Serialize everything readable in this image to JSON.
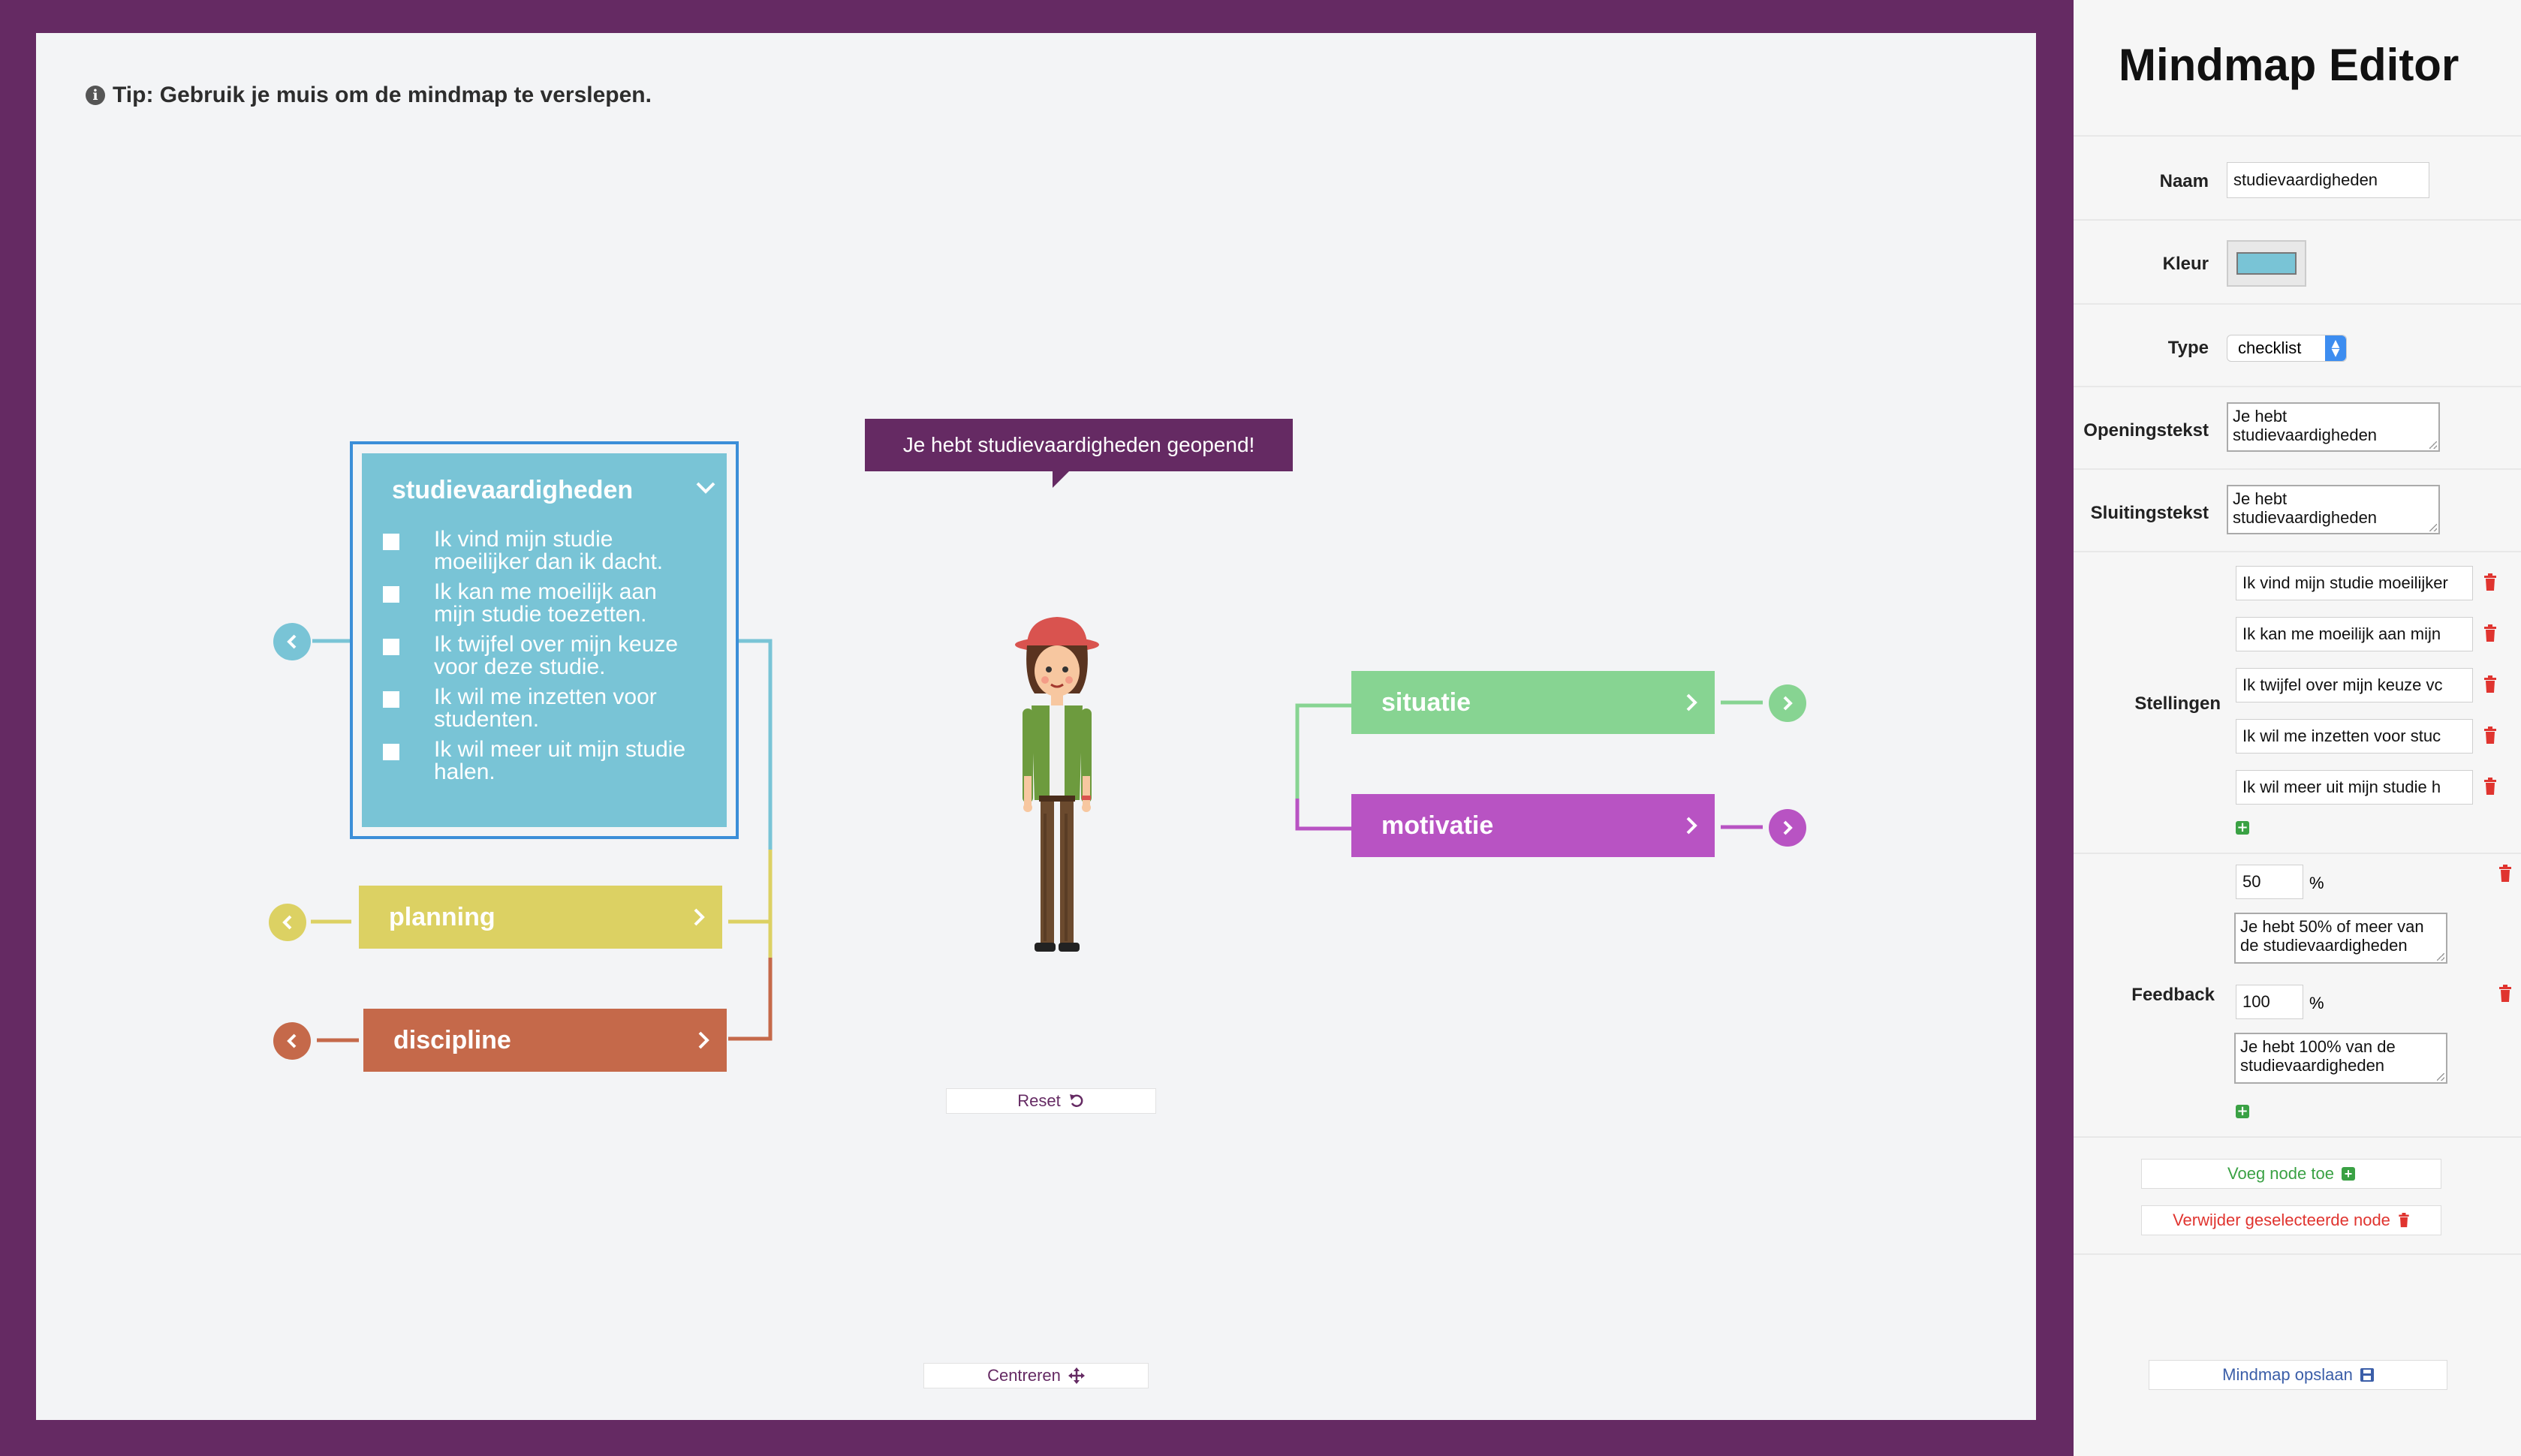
{
  "tip": "Tip: Gebruik je muis om de mindmap te verslepen.",
  "bubble": "Je hebt studievaardigheden geopend!",
  "main_node": {
    "title": "studievaardigheden",
    "items": [
      "Ik vind mijn studie moeilijker dan ik dacht.",
      "Ik kan me moeilijk aan mijn studie toezetten.",
      "Ik twijfel over mijn keuze voor deze studie.",
      "Ik wil me inzetten voor studenten.",
      "Ik wil meer uit mijn studie halen."
    ]
  },
  "nodes": {
    "planning": "planning",
    "discipline": "discipline",
    "situatie": "situatie",
    "motivatie": "motivatie"
  },
  "buttons": {
    "reset": "Reset",
    "center": "Centreren"
  },
  "colors": {
    "studie": "#79c4d6",
    "planning": "#dcd163",
    "discipline": "#c5694a",
    "situatie": "#87d492",
    "motivatie": "#b853c3",
    "purple": "#652a63"
  },
  "panel": {
    "title": "Mindmap Editor",
    "naam_label": "Naam",
    "naam_value": "studievaardigheden",
    "kleur_label": "Kleur",
    "kleur_value": "#79c4d6",
    "type_label": "Type",
    "type_value": "checklist",
    "opening_label": "Openingstekst",
    "opening_value": "Je hebt studievaardigheden",
    "sluiting_label": "Sluitingstekst",
    "sluiting_value": "Je hebt studievaardigheden",
    "stellingen_label": "Stellingen",
    "stellingen": [
      "Ik vind mijn studie moeilijker",
      "Ik kan me moeilijk aan mijn",
      "Ik twijfel over mijn keuze vc",
      "Ik wil me inzetten voor stuc",
      "Ik wil meer uit mijn studie h"
    ],
    "feedback_label": "Feedback",
    "feedback": [
      {
        "percent": "50",
        "unit": "%",
        "text": "Je hebt 50% of meer van de studievaardigheden"
      },
      {
        "percent": "100",
        "unit": "%",
        "text": "Je hebt 100% van de studievaardigheden"
      }
    ],
    "add_node": "Voeg node toe",
    "remove_node": "Verwijder geselecteerde node",
    "save": "Mindmap opslaan"
  }
}
